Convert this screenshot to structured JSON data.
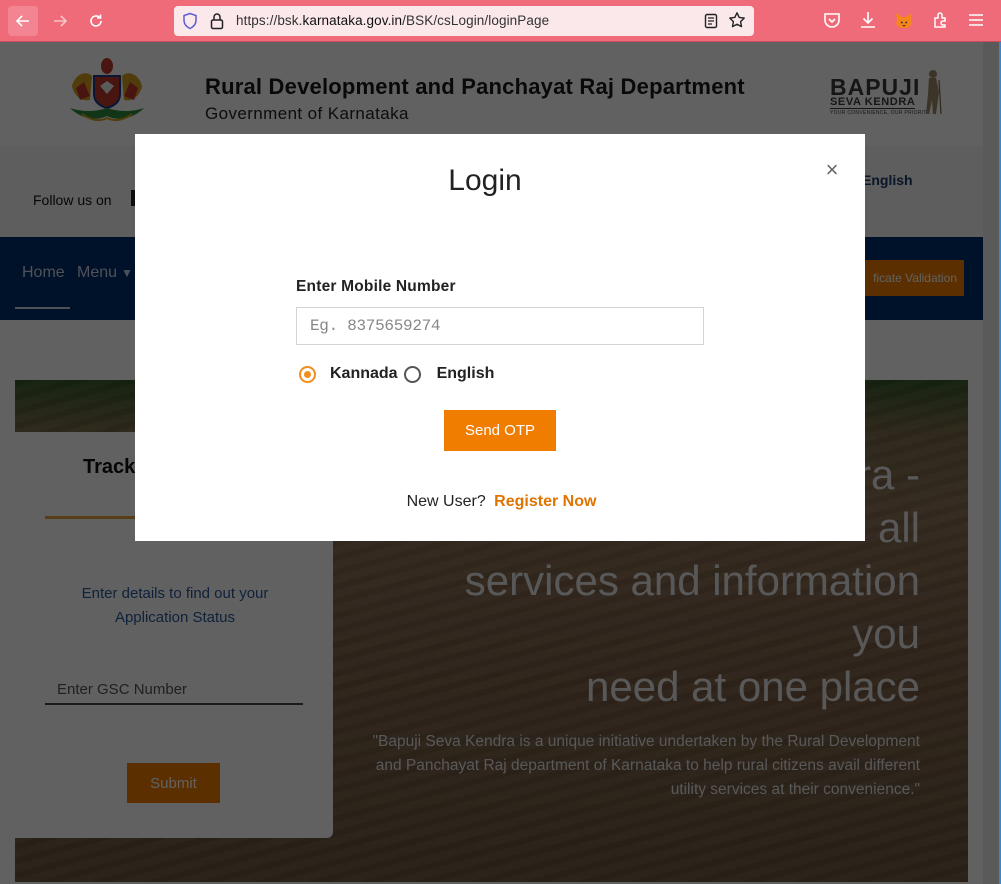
{
  "browser": {
    "url_prefix": "https://bsk.",
    "url_host": "karnataka.gov.in",
    "url_path": "/BSK/csLogin/loginPage",
    "icons": [
      "back-icon",
      "forward-icon",
      "reload-icon",
      "tracking-shield-icon",
      "lock-icon",
      "reader-view-icon",
      "bookmark-star-icon",
      "pocket-icon",
      "download-icon",
      "metamask-fox-icon",
      "extensions-icon",
      "hamburger-menu-icon"
    ],
    "accent_color": "#ef6b79"
  },
  "header": {
    "department": "Rural Development and Panchayat Raj Department",
    "government": "Government of Karnataka",
    "logo_line1": "BAPUJI",
    "logo_line2": "SEVA KENDRA",
    "logo_tagline": "YOUR CONVENIENCE, OUR PRIORITY."
  },
  "social_bar": {
    "follow_label": "Follow us on",
    "language_link": "English"
  },
  "navbar": {
    "home": "Home",
    "menu": "Menu",
    "menu_chevron": "⌄",
    "certificate_button": "Certificate Validation",
    "certificate_visible": "ficate Validation",
    "nav_color": "#002d6e"
  },
  "hero": {
    "heading_lines": [
      "Bapuji Seva Kendra -",
      "all",
      "services and information",
      "you",
      "need at one place"
    ],
    "visible_heading_lines": [
      "ra -",
      "all",
      "services and information",
      "you",
      "need at one place"
    ],
    "quote": "\"Bapuji Seva Kendra is a unique initiative undertaken by the Rural Development and Panchayat Raj department of Karnataka to help rural citizens avail different utility services at their convenience.\""
  },
  "track_card": {
    "title": "Track",
    "description": "Enter details to find out your Application Status",
    "gsc_placeholder": "Enter GSC Number",
    "submit_label": "Submit"
  },
  "modal": {
    "title": "Login",
    "close_symbol": "×",
    "mobile_label": "Enter Mobile Number",
    "mobile_placeholder": "Eg. 8375659274",
    "mobile_value": "",
    "language_options": [
      {
        "label": "Kannada",
        "checked": true
      },
      {
        "label": "English",
        "checked": false
      }
    ],
    "send_otp_label": "Send OTP",
    "new_user_text": "New User?",
    "register_label": "Register Now",
    "primary_color": "#f07c00"
  }
}
